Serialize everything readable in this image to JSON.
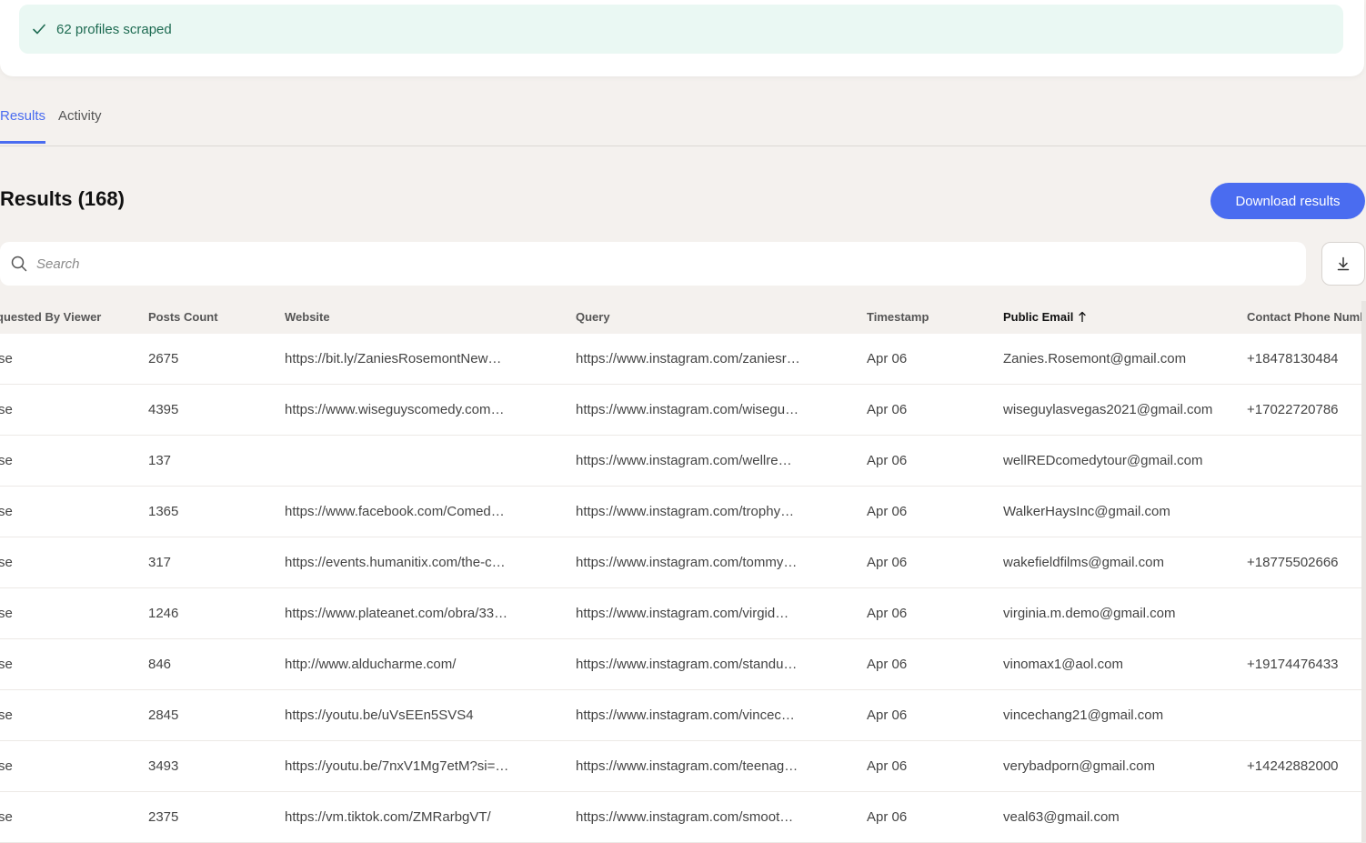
{
  "banner": {
    "text": "62 profiles scraped",
    "icon": "check-icon"
  },
  "tabs": [
    {
      "label": "Results",
      "active": true
    },
    {
      "label": "Activity",
      "active": false
    }
  ],
  "results": {
    "title": "Results (168)",
    "download_label": "Download results",
    "search_placeholder": "Search"
  },
  "table": {
    "headers": [
      "quested By Viewer",
      "Posts Count",
      "Website",
      "Query",
      "Timestamp",
      "Public Email",
      "Contact Phone Numb"
    ],
    "sorted_column": "Public Email",
    "sort_direction": "ascending",
    "rows": [
      [
        "se",
        "2675",
        "https://bit.ly/ZaniesRosemontNew…",
        "https://www.instagram.com/zaniesr…",
        "Apr 06",
        "Zanies.Rosemont@gmail.com",
        "+18478130484"
      ],
      [
        "se",
        "4395",
        "https://www.wiseguyscomedy.com…",
        "https://www.instagram.com/wisegu…",
        "Apr 06",
        "wiseguylasvegas2021@gmail.com",
        "+17022720786"
      ],
      [
        "se",
        "137",
        "",
        "https://www.instagram.com/wellre…",
        "Apr 06",
        "wellREDcomedytour@gmail.com",
        ""
      ],
      [
        "se",
        "1365",
        "https://www.facebook.com/Comed…",
        "https://www.instagram.com/trophy…",
        "Apr 06",
        "WalkerHaysInc@gmail.com",
        ""
      ],
      [
        "se",
        "317",
        "https://events.humanitix.com/the-c…",
        "https://www.instagram.com/tommy…",
        "Apr 06",
        "wakefieldfilms@gmail.com",
        "+18775502666"
      ],
      [
        "se",
        "1246",
        "https://www.plateanet.com/obra/33…",
        "https://www.instagram.com/virgid…",
        "Apr 06",
        "virginia.m.demo@gmail.com",
        ""
      ],
      [
        "se",
        "846",
        "http://www.alducharme.com/",
        "https://www.instagram.com/standu…",
        "Apr 06",
        "vinomax1@aol.com",
        "+19174476433"
      ],
      [
        "se",
        "2845",
        "https://youtu.be/uVsEEn5SVS4",
        "https://www.instagram.com/vincec…",
        "Apr 06",
        "vincechang21@gmail.com",
        ""
      ],
      [
        "se",
        "3493",
        "https://youtu.be/7nxV1Mg7etM?si=…",
        "https://www.instagram.com/teenag…",
        "Apr 06",
        "verybadporn@gmail.com",
        "+14242882000"
      ],
      [
        "se",
        "2375",
        "https://vm.tiktok.com/ZMRarbgVT/",
        "https://www.instagram.com/smoot…",
        "Apr 06",
        "veal63@gmail.com",
        ""
      ]
    ]
  },
  "colors": {
    "accent": "#4a6cf0",
    "success_bg": "#eaf8f3",
    "success_text": "#1e6b52",
    "page_bg": "#f4f1ee"
  }
}
